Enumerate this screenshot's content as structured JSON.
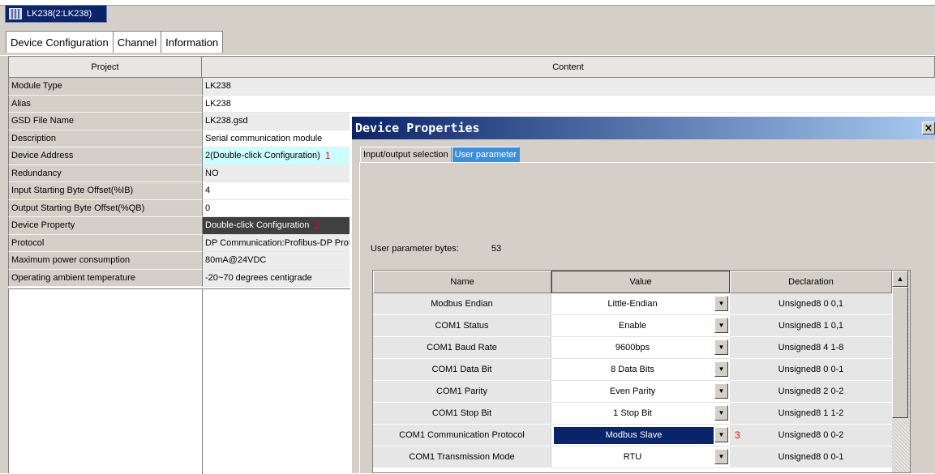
{
  "window_tab": {
    "label": "LK238(2:LK238)"
  },
  "page_tabs": [
    {
      "label": "Device Configuration"
    },
    {
      "label": "Channel"
    },
    {
      "label": "Information"
    }
  ],
  "property_table": {
    "headers": {
      "project": "Project",
      "content": "Content"
    },
    "rows": [
      {
        "key": "Module Type",
        "value": "LK238"
      },
      {
        "key": "Alias",
        "value": "LK238"
      },
      {
        "key": "GSD File Name",
        "value": "LK238.gsd"
      },
      {
        "key": "Description",
        "value": "Serial communication module"
      },
      {
        "key": "Device Address",
        "value": "2(Double-click Configuration)",
        "marker": "1"
      },
      {
        "key": "Redundancy",
        "value": "NO"
      },
      {
        "key": "Input Starting Byte Offset(%IB)",
        "value": "4"
      },
      {
        "key": "Output Starting Byte Offset(%QB)",
        "value": "0"
      },
      {
        "key": "Device Property",
        "value": "Double-click Configuration",
        "marker": "2"
      },
      {
        "key": "Protocol",
        "value": "DP Communication:Profibus-DP Prof"
      },
      {
        "key": "Maximum power consumption",
        "value": "80mA@24VDC"
      },
      {
        "key": "Operating ambient temperature",
        "value": "-20~70 degrees centigrade"
      }
    ]
  },
  "dialog": {
    "title": "Device Properties",
    "close": "×",
    "tabs": [
      {
        "label": "Input/output selection"
      },
      {
        "label": "User parameter"
      }
    ],
    "user_param_label": "User parameter bytes:",
    "user_param_value": "53",
    "grid_headers": {
      "name": "Name",
      "value": "Value",
      "declaration": "Declaration"
    },
    "grid_rows": [
      {
        "name": "Modbus Endian",
        "value": "Little-Endian",
        "declaration": "Unsigned8 0 0,1"
      },
      {
        "name": "COM1 Status",
        "value": "Enable",
        "declaration": "Unsigned8 1 0,1"
      },
      {
        "name": "COM1 Baud Rate",
        "value": "9600bps",
        "declaration": "Unsigned8 4 1-8"
      },
      {
        "name": "COM1 Data Bit",
        "value": "8 Data Bits",
        "declaration": "Unsigned8 0 0-1"
      },
      {
        "name": "COM1 Parity",
        "value": "Even Parity",
        "declaration": "Unsigned8 2 0-2"
      },
      {
        "name": "COM1 Stop Bit",
        "value": "1 Stop Bit",
        "declaration": "Unsigned8 1 1-2"
      },
      {
        "name": "COM1 Communication Protocol",
        "value": "Modbus Slave",
        "declaration": "Unsigned8 0 0-2",
        "marker": "3"
      },
      {
        "name": "COM1 Transmission Mode",
        "value": "RTU",
        "declaration": "Unsigned8 0 0-1"
      }
    ]
  }
}
